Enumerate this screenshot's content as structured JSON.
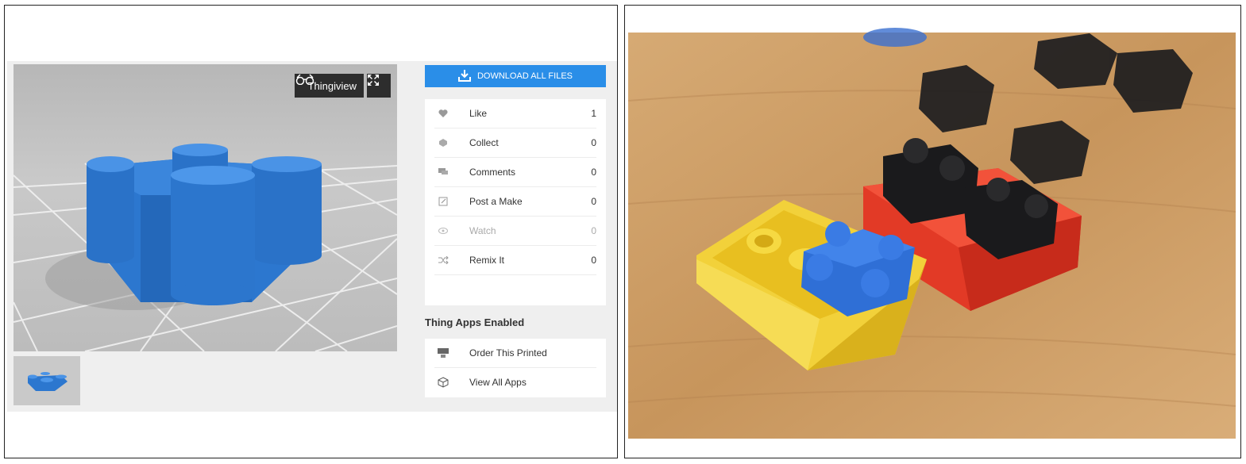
{
  "viewer": {
    "thingiview_label": "Thingiview",
    "icons": [
      "glasses-icon",
      "fullscreen-icon"
    ]
  },
  "download": {
    "label": "DOWNLOAD ALL FILES",
    "icon": "download-icon"
  },
  "actions": [
    {
      "label": "Like",
      "count": "1",
      "icon": "heart-icon"
    },
    {
      "label": "Collect",
      "count": "0",
      "icon": "collect-icon"
    },
    {
      "label": "Comments",
      "count": "0",
      "icon": "comments-icon"
    },
    {
      "label": "Post a Make",
      "count": "0",
      "icon": "post-make-icon"
    },
    {
      "label": "Watch",
      "count": "0",
      "icon": "eye-icon"
    },
    {
      "label": "Remix It",
      "count": "0",
      "icon": "remix-icon"
    }
  ],
  "apps": {
    "title": "Thing Apps Enabled",
    "items": [
      {
        "label": "Order This Printed",
        "icon": "printer-icon"
      },
      {
        "label": "View All Apps",
        "icon": "cube-icon"
      }
    ]
  },
  "colors": {
    "accent": "#2a8ee8",
    "brick_blue": "#2d78d0",
    "brick_yellow": "#f3d233",
    "brick_red": "#e53424",
    "brick_black": "#1c1c1e",
    "wood": "#c99a62"
  }
}
